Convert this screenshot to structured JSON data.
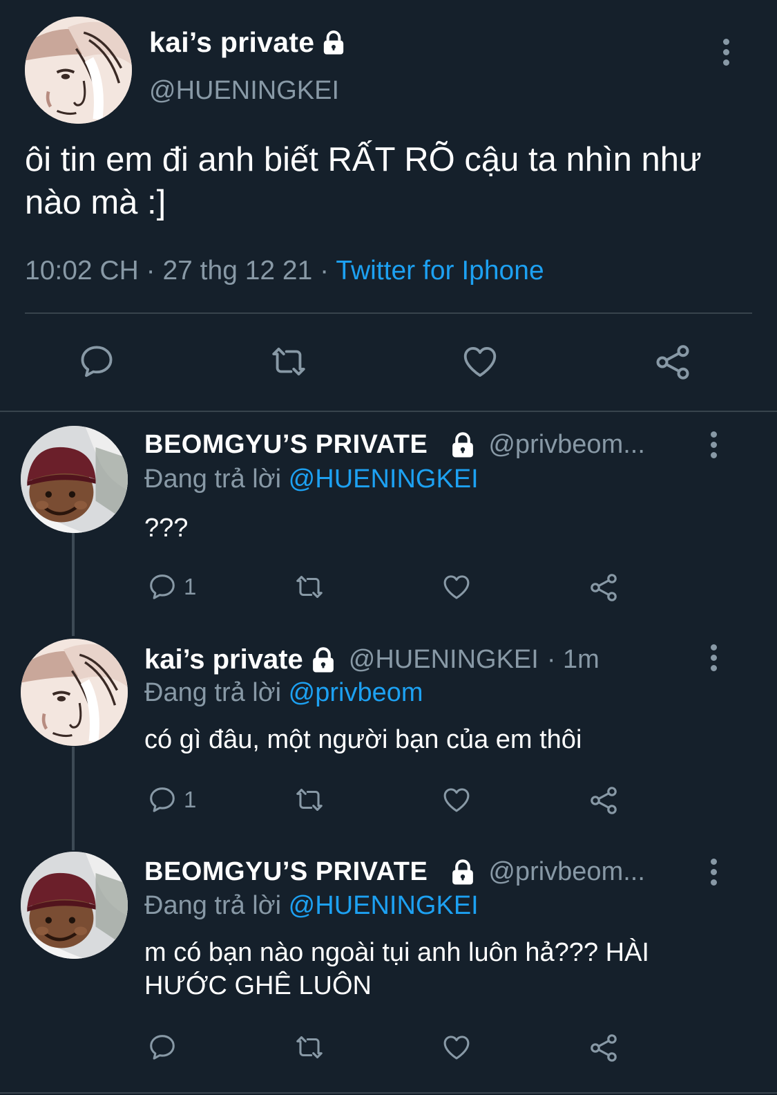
{
  "main_tweet": {
    "display_name": "kai’s private",
    "handle": "@HUENINGKEI",
    "text": "ôi tin em đi anh biết RẤT RÕ cậu ta nhìn như nào mà :]",
    "time": "10:02 CH",
    "date": "27 thg 12 21",
    "separator": "·",
    "source": "Twitter for Iphone",
    "locked": true,
    "avatar_icon": "cartoon-face-avatar"
  },
  "replies": [
    {
      "display_name": "BEOMGYU’S PRIVATE",
      "handle": "@privbeom...",
      "time": "",
      "replying_prefix": "Đang trả lời",
      "replying_to": "@HUENINGKEI",
      "text": "???",
      "reply_count": "1",
      "avatar_icon": "child-in-beanie-avatar"
    },
    {
      "display_name": "kai’s private",
      "handle": "@HUENINGKEI",
      "time": "· 1m",
      "replying_prefix": "Đang trả lời",
      "replying_to": "@privbeom",
      "text": "có gì đâu, một người bạn của em thôi",
      "reply_count": "1",
      "avatar_icon": "cartoon-face-avatar"
    },
    {
      "display_name": "BEOMGYU’S PRIVATE",
      "handle": "@privbeom...",
      "time": "",
      "replying_prefix": "Đang trả lời",
      "replying_to": "@HUENINGKEI",
      "text": "m có bạn nào ngoài tụi anh luôn hả??? HÀI HƯỚC GHÊ LUÔN",
      "reply_count": "",
      "avatar_icon": "child-in-beanie-avatar"
    }
  ],
  "colors": {
    "background": "#15202b",
    "secondary_text": "#8899a6",
    "link": "#1da1f2",
    "divider": "#38444d"
  },
  "icons": [
    "reply-icon",
    "retweet-icon",
    "like-icon",
    "share-icon",
    "lock-icon",
    "more-icon"
  ]
}
